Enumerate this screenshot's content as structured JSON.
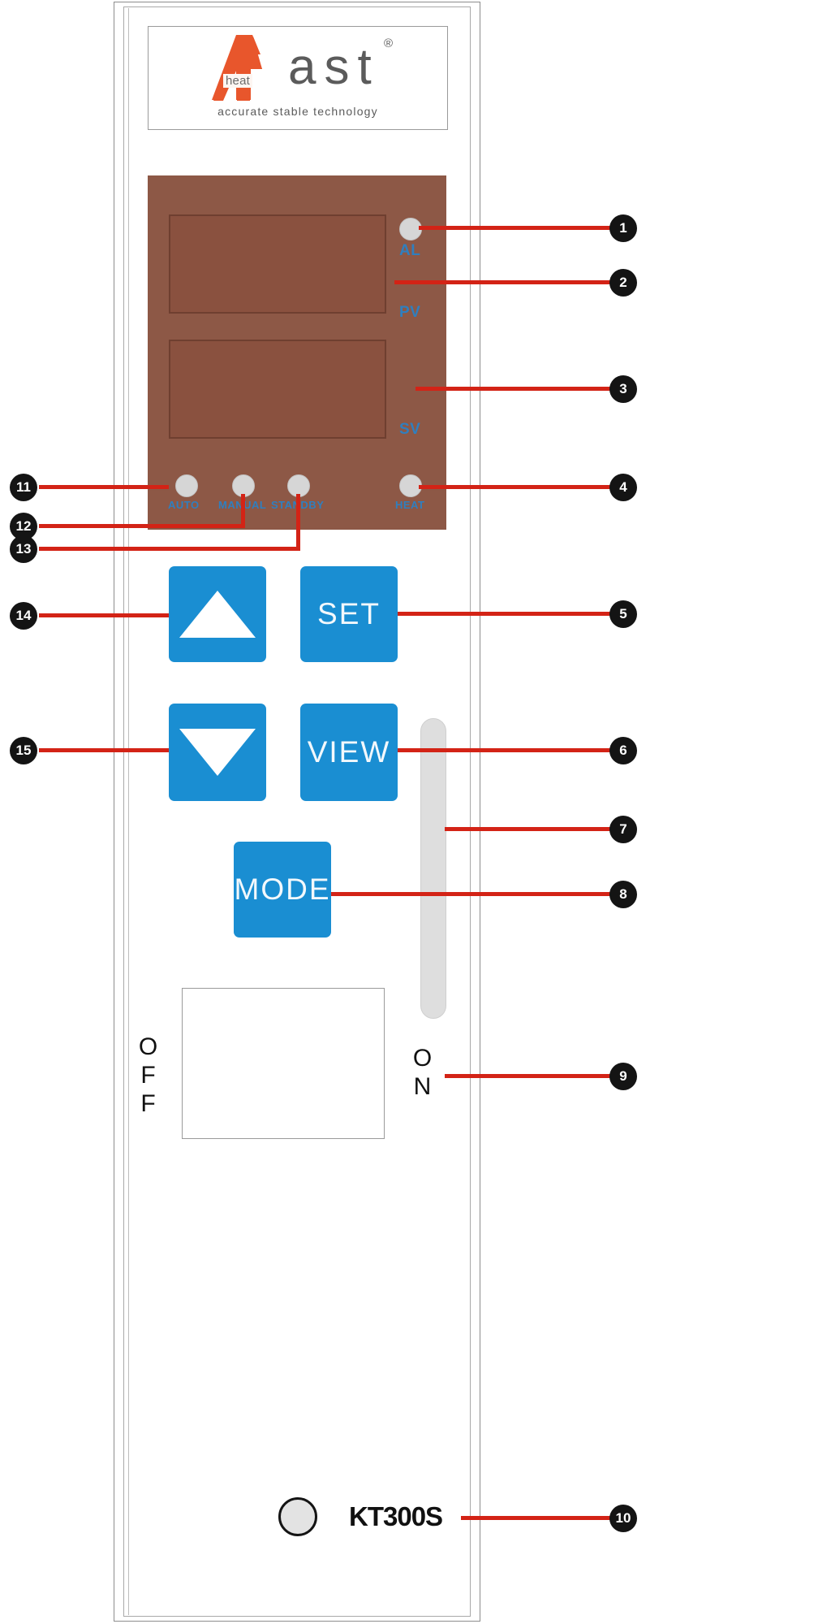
{
  "device": {
    "model": "KT300S",
    "brand": {
      "mark_letter": "A",
      "inner_badge": "heat",
      "wordmark": "ast",
      "registered": "®",
      "tagline": "accurate  stable  technology"
    }
  },
  "display": {
    "background_color": "#8d5846",
    "windows": [
      {
        "name": "process-value-window",
        "label": "PV"
      },
      {
        "name": "set-value-window",
        "label": "SV"
      }
    ],
    "side_labels": [
      {
        "id": "al",
        "text": "AL"
      },
      {
        "id": "pv",
        "text": "PV"
      },
      {
        "id": "sv",
        "text": "SV"
      },
      {
        "id": "heat",
        "text": "HEAT"
      }
    ],
    "status_labels": [
      {
        "id": "auto",
        "text": "AUTO"
      },
      {
        "id": "manual",
        "text": "MANUAL"
      },
      {
        "id": "standby",
        "text": "STANDBY"
      }
    ],
    "label_color": "#2f7fbf",
    "led_color": "#d6d6d6"
  },
  "buttons": {
    "color": "#1a8ed2",
    "text_color": "#f2f8fc",
    "items": [
      {
        "id": "up",
        "label": "",
        "icon": "triangle-up-icon"
      },
      {
        "id": "set",
        "label": "SET",
        "icon": ""
      },
      {
        "id": "down",
        "label": "",
        "icon": "triangle-down-icon"
      },
      {
        "id": "view",
        "label": "VIEW",
        "icon": ""
      },
      {
        "id": "mode",
        "label": "MODE",
        "icon": ""
      }
    ]
  },
  "power_switch": {
    "name": "power-rocker-switch",
    "off_label": "OFF",
    "on_label": "ON",
    "color": "#dedede"
  },
  "callouts": {
    "line_color": "#d32316",
    "badge_color": "#141414",
    "items": [
      {
        "n": "1",
        "target": "al-led"
      },
      {
        "n": "2",
        "target": "pv-display-window"
      },
      {
        "n": "3",
        "target": "sv-display-window"
      },
      {
        "n": "4",
        "target": "heat-led"
      },
      {
        "n": "5",
        "target": "set-button"
      },
      {
        "n": "6",
        "target": "view-button"
      },
      {
        "n": "7",
        "target": "power-rocker-switch"
      },
      {
        "n": "8",
        "target": "mode-button"
      },
      {
        "n": "9",
        "target": "on-position-label"
      },
      {
        "n": "10",
        "target": "model-label"
      },
      {
        "n": "11",
        "target": "auto-led"
      },
      {
        "n": "12",
        "target": "manual-led"
      },
      {
        "n": "13",
        "target": "standby-led"
      },
      {
        "n": "14",
        "target": "up-button"
      },
      {
        "n": "15",
        "target": "down-button"
      }
    ]
  }
}
